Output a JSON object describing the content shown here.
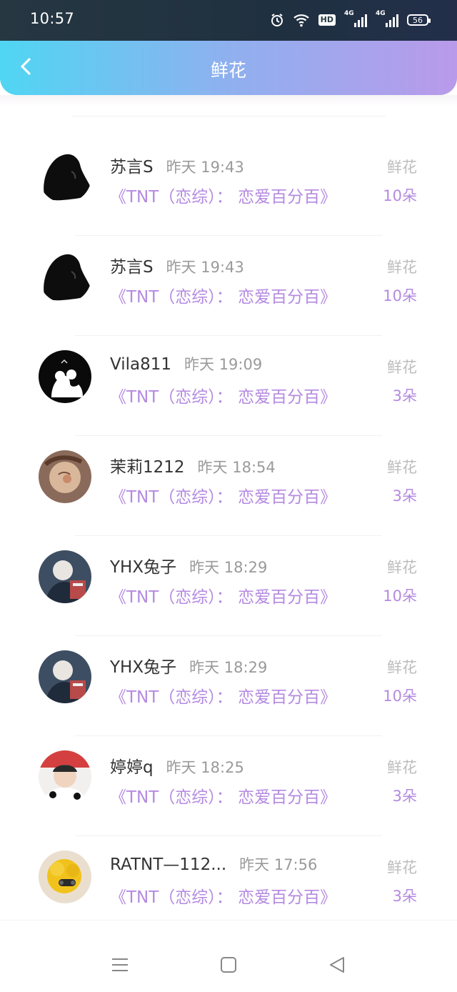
{
  "status_bar": {
    "time": "10:57",
    "hd_label": "HD",
    "signal_labels": [
      "4G",
      "4G"
    ],
    "battery": "56",
    "icons": [
      "alarm-icon",
      "wifi-icon",
      "hd-icon",
      "signal-icon",
      "signal-icon",
      "battery-icon"
    ]
  },
  "header": {
    "title": "鲜花",
    "back_icon": "chevron-left-icon",
    "gradient": [
      "#4fd6f2",
      "#b99aea"
    ]
  },
  "colors": {
    "accent": "#b48ae0",
    "muted": "#9a9a9a"
  },
  "records": [
    {
      "name": "苏言S",
      "time": "昨天 19:43",
      "show": "《TNT（恋综）： 恋爱百分百》",
      "gift_label": "鲜花",
      "count": "10朵"
    },
    {
      "name": "苏言S",
      "time": "昨天 19:43",
      "show": "《TNT（恋综）： 恋爱百分百》",
      "gift_label": "鲜花",
      "count": "10朵"
    },
    {
      "name": "Vila811",
      "time": "昨天 19:09",
      "show": "《TNT（恋综）： 恋爱百分百》",
      "gift_label": "鲜花",
      "count": "3朵"
    },
    {
      "name": "茉莉1212",
      "time": "昨天 18:54",
      "show": "《TNT（恋综）： 恋爱百分百》",
      "gift_label": "鲜花",
      "count": "3朵"
    },
    {
      "name": "YHX兔子",
      "time": "昨天 18:29",
      "show": "《TNT（恋综）： 恋爱百分百》",
      "gift_label": "鲜花",
      "count": "10朵"
    },
    {
      "name": "YHX兔子",
      "time": "昨天 18:29",
      "show": "《TNT（恋综）： 恋爱百分百》",
      "gift_label": "鲜花",
      "count": "10朵"
    },
    {
      "name": "婷婷q",
      "time": "昨天 18:25",
      "show": "《TNT（恋综）： 恋爱百分百》",
      "gift_label": "鲜花",
      "count": "3朵"
    },
    {
      "name": "RATNT—112...",
      "time": "昨天 17:56",
      "show": "《TNT（恋综）： 恋爱百分百》",
      "gift_label": "鲜花",
      "count": "3朵"
    }
  ],
  "nav_bar": {
    "icons": [
      "menu-icon",
      "home-icon",
      "back-triangle-icon"
    ]
  }
}
